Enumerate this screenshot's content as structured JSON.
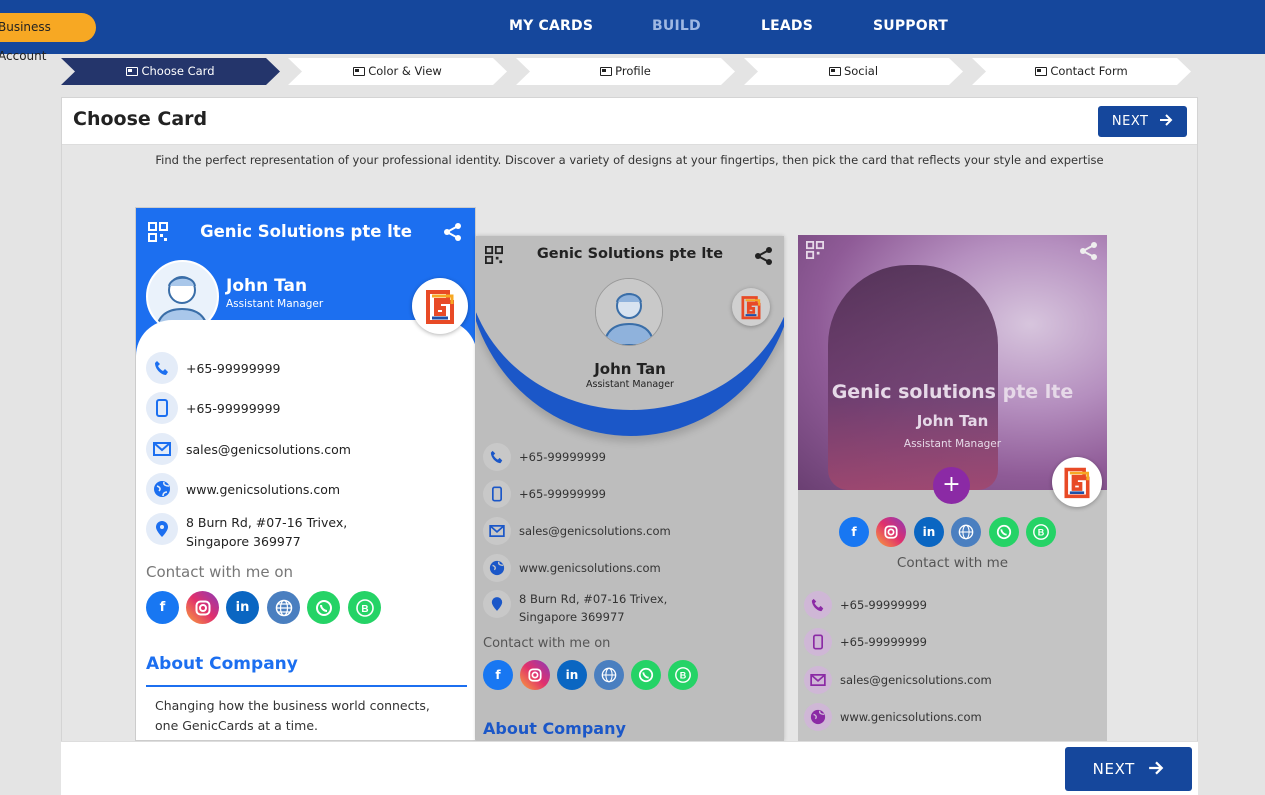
{
  "topbar": {
    "business_button": "Business Account",
    "nav": [
      "MY CARDS",
      "BUILD",
      "LEADS",
      "SUPPORT"
    ]
  },
  "stepper": [
    "Choose Card",
    "Color & View",
    "Profile",
    "Social",
    "Contact Form"
  ],
  "panel": {
    "title": "Choose Card",
    "next_label": "NEXT",
    "intro": "Find the perfect representation of your professional identity. Discover a variety of designs at your fingertips, then pick the card that reflects your style and expertise"
  },
  "card1": {
    "company": "Genic Solutions pte lte",
    "name": "John Tan",
    "role": "Assistant Manager",
    "phone": "+65-99999999",
    "mobile": "+65-99999999",
    "email": "sales@genicsolutions.com",
    "website": "www.genicsolutions.com",
    "address_line1": "8 Burn Rd, #07-16 Trivex,",
    "address_line2": "Singapore 369977",
    "contact_title": "Contact with me on",
    "about_title": "About Company",
    "about_text": "Changing how the business world connects, one GenicCards at a time."
  },
  "card2": {
    "company": "Genic Solutions pte lte",
    "name": "John Tan",
    "role": "Assistant Manager",
    "phone": "+65-99999999",
    "mobile": "+65-99999999",
    "email": "sales@genicsolutions.com",
    "website": "www.genicsolutions.com",
    "address_line1": "8 Burn Rd, #07-16 Trivex,",
    "address_line2": "Singapore 369977",
    "contact_title": "Contact with me on",
    "about_title": "About Company"
  },
  "card3": {
    "company": "Genic solutions pte lte",
    "name": "John Tan",
    "role": "Assistant Manager",
    "plus": "+",
    "contact_title": "Contact with me",
    "phone": "+65-99999999",
    "mobile": "+65-99999999",
    "email": "sales@genicsolutions.com",
    "website": "www.genicsolutions.com"
  },
  "social_icons": [
    "facebook-icon",
    "instagram-icon",
    "linkedin-icon",
    "globe-icon",
    "whatsapp-icon",
    "whatsapp-business-icon"
  ],
  "social_glyphs": {
    "facebook": "f",
    "linkedin": "in",
    "business": "B"
  },
  "footer": {
    "next_label": "NEXT"
  },
  "colors": {
    "nav_blue": "#15479c",
    "accent_orange": "#f7a823",
    "card1_blue": "#1c6ff0",
    "card2_arc": "#1b57c8",
    "card3_purple": "#8b2aa5"
  }
}
